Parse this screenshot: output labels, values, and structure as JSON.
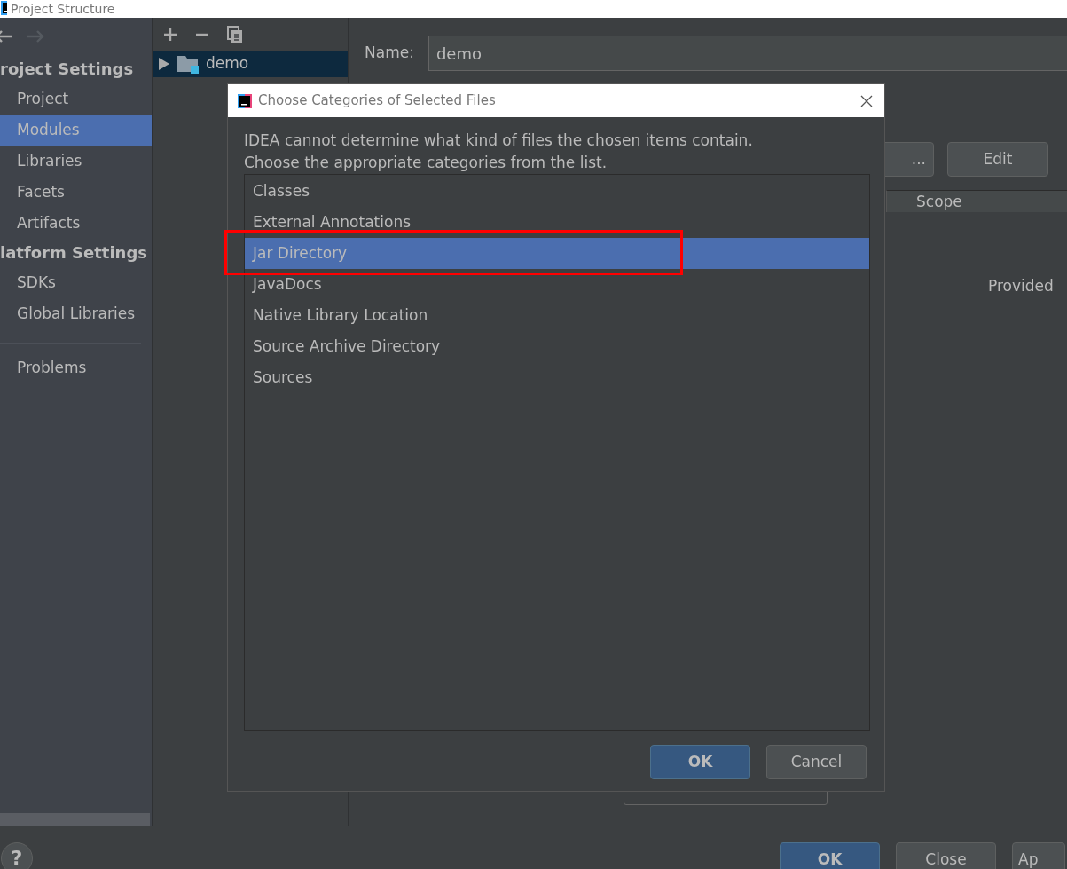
{
  "window": {
    "title": "Project Structure"
  },
  "sidebar": {
    "sections": [
      {
        "heading": "roject Settings",
        "items": [
          {
            "label": "Project",
            "selected": false
          },
          {
            "label": "Modules",
            "selected": true
          },
          {
            "label": "Libraries",
            "selected": false
          },
          {
            "label": "Facets",
            "selected": false
          },
          {
            "label": "Artifacts",
            "selected": false
          }
        ]
      },
      {
        "heading": "latform Settings",
        "items": [
          {
            "label": "SDKs",
            "selected": false
          },
          {
            "label": "Global Libraries",
            "selected": false
          }
        ]
      }
    ],
    "footer_items": [
      {
        "label": "Problems",
        "selected": false
      }
    ]
  },
  "tree": {
    "items": [
      {
        "label": "demo",
        "expanded": false,
        "selected": true
      }
    ]
  },
  "module": {
    "name_label": "Name:",
    "name_value": "demo",
    "buttons": [
      "...",
      "Edit"
    ],
    "columns": [
      "Scope"
    ],
    "rows": [
      {
        "scope": "Provided"
      }
    ]
  },
  "dialog": {
    "title": "Choose Categories of Selected Files",
    "message_lines": [
      "IDEA cannot determine what kind of files the chosen items contain.",
      "Choose the appropriate categories from the list."
    ],
    "items": [
      {
        "label": "Classes",
        "selected": false
      },
      {
        "label": "External Annotations",
        "selected": false
      },
      {
        "label": "Jar Directory",
        "selected": true
      },
      {
        "label": "JavaDocs",
        "selected": false
      },
      {
        "label": "Native Library Location",
        "selected": false
      },
      {
        "label": "Source Archive Directory",
        "selected": false
      },
      {
        "label": "Sources",
        "selected": false
      }
    ],
    "buttons": [
      {
        "label": "OK",
        "primary": true
      },
      {
        "label": "Cancel",
        "primary": false
      }
    ]
  },
  "footer": {
    "help": "?",
    "buttons": [
      {
        "label": "OK",
        "primary": true
      },
      {
        "label": "Close",
        "primary": false
      },
      {
        "label": "Ap",
        "primary": false
      }
    ]
  }
}
